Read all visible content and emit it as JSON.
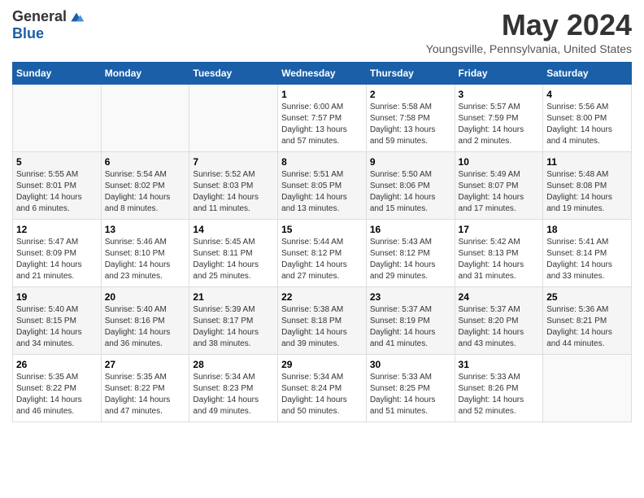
{
  "header": {
    "logo": {
      "general": "General",
      "blue": "Blue",
      "tagline": ""
    },
    "title": "May 2024",
    "location": "Youngsville, Pennsylvania, United States"
  },
  "days_of_week": [
    "Sunday",
    "Monday",
    "Tuesday",
    "Wednesday",
    "Thursday",
    "Friday",
    "Saturday"
  ],
  "weeks": [
    [
      {
        "num": "",
        "empty": true
      },
      {
        "num": "",
        "empty": true
      },
      {
        "num": "",
        "empty": true
      },
      {
        "num": "1",
        "sunrise": "6:00 AM",
        "sunset": "7:57 PM",
        "daylight": "13 hours and 57 minutes."
      },
      {
        "num": "2",
        "sunrise": "5:58 AM",
        "sunset": "7:58 PM",
        "daylight": "13 hours and 59 minutes."
      },
      {
        "num": "3",
        "sunrise": "5:57 AM",
        "sunset": "7:59 PM",
        "daylight": "14 hours and 2 minutes."
      },
      {
        "num": "4",
        "sunrise": "5:56 AM",
        "sunset": "8:00 PM",
        "daylight": "14 hours and 4 minutes."
      }
    ],
    [
      {
        "num": "5",
        "sunrise": "5:55 AM",
        "sunset": "8:01 PM",
        "daylight": "14 hours and 6 minutes."
      },
      {
        "num": "6",
        "sunrise": "5:54 AM",
        "sunset": "8:02 PM",
        "daylight": "14 hours and 8 minutes."
      },
      {
        "num": "7",
        "sunrise": "5:52 AM",
        "sunset": "8:03 PM",
        "daylight": "14 hours and 11 minutes."
      },
      {
        "num": "8",
        "sunrise": "5:51 AM",
        "sunset": "8:05 PM",
        "daylight": "14 hours and 13 minutes."
      },
      {
        "num": "9",
        "sunrise": "5:50 AM",
        "sunset": "8:06 PM",
        "daylight": "14 hours and 15 minutes."
      },
      {
        "num": "10",
        "sunrise": "5:49 AM",
        "sunset": "8:07 PM",
        "daylight": "14 hours and 17 minutes."
      },
      {
        "num": "11",
        "sunrise": "5:48 AM",
        "sunset": "8:08 PM",
        "daylight": "14 hours and 19 minutes."
      }
    ],
    [
      {
        "num": "12",
        "sunrise": "5:47 AM",
        "sunset": "8:09 PM",
        "daylight": "14 hours and 21 minutes."
      },
      {
        "num": "13",
        "sunrise": "5:46 AM",
        "sunset": "8:10 PM",
        "daylight": "14 hours and 23 minutes."
      },
      {
        "num": "14",
        "sunrise": "5:45 AM",
        "sunset": "8:11 PM",
        "daylight": "14 hours and 25 minutes."
      },
      {
        "num": "15",
        "sunrise": "5:44 AM",
        "sunset": "8:12 PM",
        "daylight": "14 hours and 27 minutes."
      },
      {
        "num": "16",
        "sunrise": "5:43 AM",
        "sunset": "8:12 PM",
        "daylight": "14 hours and 29 minutes."
      },
      {
        "num": "17",
        "sunrise": "5:42 AM",
        "sunset": "8:13 PM",
        "daylight": "14 hours and 31 minutes."
      },
      {
        "num": "18",
        "sunrise": "5:41 AM",
        "sunset": "8:14 PM",
        "daylight": "14 hours and 33 minutes."
      }
    ],
    [
      {
        "num": "19",
        "sunrise": "5:40 AM",
        "sunset": "8:15 PM",
        "daylight": "14 hours and 34 minutes."
      },
      {
        "num": "20",
        "sunrise": "5:40 AM",
        "sunset": "8:16 PM",
        "daylight": "14 hours and 36 minutes."
      },
      {
        "num": "21",
        "sunrise": "5:39 AM",
        "sunset": "8:17 PM",
        "daylight": "14 hours and 38 minutes."
      },
      {
        "num": "22",
        "sunrise": "5:38 AM",
        "sunset": "8:18 PM",
        "daylight": "14 hours and 39 minutes."
      },
      {
        "num": "23",
        "sunrise": "5:37 AM",
        "sunset": "8:19 PM",
        "daylight": "14 hours and 41 minutes."
      },
      {
        "num": "24",
        "sunrise": "5:37 AM",
        "sunset": "8:20 PM",
        "daylight": "14 hours and 43 minutes."
      },
      {
        "num": "25",
        "sunrise": "5:36 AM",
        "sunset": "8:21 PM",
        "daylight": "14 hours and 44 minutes."
      }
    ],
    [
      {
        "num": "26",
        "sunrise": "5:35 AM",
        "sunset": "8:22 PM",
        "daylight": "14 hours and 46 minutes."
      },
      {
        "num": "27",
        "sunrise": "5:35 AM",
        "sunset": "8:22 PM",
        "daylight": "14 hours and 47 minutes."
      },
      {
        "num": "28",
        "sunrise": "5:34 AM",
        "sunset": "8:23 PM",
        "daylight": "14 hours and 49 minutes."
      },
      {
        "num": "29",
        "sunrise": "5:34 AM",
        "sunset": "8:24 PM",
        "daylight": "14 hours and 50 minutes."
      },
      {
        "num": "30",
        "sunrise": "5:33 AM",
        "sunset": "8:25 PM",
        "daylight": "14 hours and 51 minutes."
      },
      {
        "num": "31",
        "sunrise": "5:33 AM",
        "sunset": "8:26 PM",
        "daylight": "14 hours and 52 minutes."
      },
      {
        "num": "",
        "empty": true
      }
    ]
  ],
  "labels": {
    "sunrise": "Sunrise:",
    "sunset": "Sunset:",
    "daylight": "Daylight:"
  }
}
